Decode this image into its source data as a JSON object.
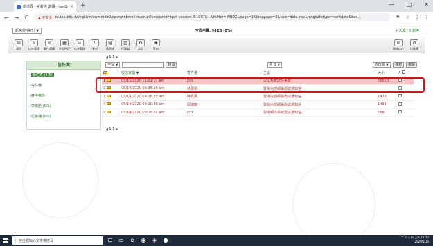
{
  "browser": {
    "tab_title": "新增頁 - 4 封信 未讀 - tpc@ccc...",
    "tab_close": "✕",
    "new_tab": "+",
    "window_buttons": [
      "—",
      "□",
      "✕"
    ],
    "nav": [
      "←",
      "→",
      "C"
    ],
    "security_label": "▲ 不安全",
    "url": "cc.tpa.edu.tw/cgi-bin/owmmdir2/openwebmail-main.pl?sessionid=tpc*-session-0.19070…&folder=INBOX&page=1&longpage=0&sort=date_rev&msgdatetype=sentdate&bac…",
    "toolbar_icons": [
      "⚑",
      "☆",
      "θ",
      "⋮"
    ]
  },
  "app": {
    "account_select": "新信夾 (4/5) ▼",
    "quota": "空間用量: 94KB (0%)",
    "counts": "4 未讀 / 5 封信",
    "tools_left": [
      {
        "icon": "✉",
        "label": "寫信"
      },
      {
        "icon": "✎",
        "label": "信夾管理"
      },
      {
        "icon": "✉",
        "label": "郵件選擇"
      },
      {
        "icon": "▦",
        "label": "外部POP"
      },
      {
        "icon": "≡",
        "label": "信夾管理"
      },
      {
        "icon": "↻",
        "label": "更新"
      },
      {
        "icon": "▤",
        "label": "通訊錄"
      },
      {
        "icon": "▥",
        "label": "行事曆"
      },
      {
        "icon": "⚙",
        "label": "設定"
      },
      {
        "icon": "✚",
        "label": "登出"
      }
    ],
    "tools_right": [
      {
        "icon": "✉",
        "label": "刪除信件"
      },
      {
        "icon": "↺",
        "label": "垃圾桶"
      }
    ],
    "pager_top": "◀ 1/1 ▶",
    "pager_bottom": "◀ 1/1 ▶",
    "sidebar": {
      "title": "信件夾",
      "folders": [
        {
          "label": "新信夾 (4/5)",
          "active": true
        },
        {
          "label": "寄件備",
          "active": false
        },
        {
          "label": "寄件備份",
          "active": false
        },
        {
          "label": "草稿匣 (0/1)",
          "active": false
        },
        {
          "label": "垃圾桶 (0/0)",
          "active": false
        }
      ]
    },
    "search": {
      "field_select": "主旨 ▼",
      "button": "搜尋",
      "page_select": "頁 1 ▼",
      "sort_select": "依日期 ▼",
      "move_button": "移到",
      "copy_button": "複製"
    },
    "columns": [
      "",
      "收信日期 ▼",
      "寄件者",
      "主旨",
      "大小",
      "A"
    ],
    "rows": [
      {
        "num": "1.",
        "date": "05/15/2020 11:22:01 am",
        "from": "Eric",
        "subject": "公文系統送件事宜",
        "size": "568KB"
      },
      {
        "num": "2.",
        "date": "05/14/2020 09:36:56 am",
        "from": "林思穎",
        "subject": "警衛內部網路測試通知信",
        "size": ""
      },
      {
        "num": "3.",
        "date": "05/14/2020 09:26:35 am",
        "from": "陳秀惠",
        "subject": "警衛內部網路測試通知信",
        "size": "1472"
      },
      {
        "num": "4.",
        "date": "05/14/2020 09:20:36 am",
        "from": "鄭瑞龍",
        "subject": "警衛內部網路測試通知信",
        "size": "1493"
      },
      {
        "num": "5.",
        "date": "05/14/2020 09:15:24 am",
        "from": "Eric",
        "subject": "警衛郵件系統測試通知信",
        "size": "5KB"
      }
    ]
  },
  "taskbar": {
    "search_placeholder": "在這裡輸入文字來搜尋",
    "apps": [
      "⊟",
      "▭",
      "e",
      "◉",
      "◈",
      "●"
    ],
    "time": "上午 11:22",
    "date": "2020/5/15",
    "tray": "^ ⊡ ◁ 中"
  },
  "colors": {
    "highlight_border": "#d11111",
    "active_folder": "#3e8e3e",
    "header_green": "#d6e9d0"
  }
}
